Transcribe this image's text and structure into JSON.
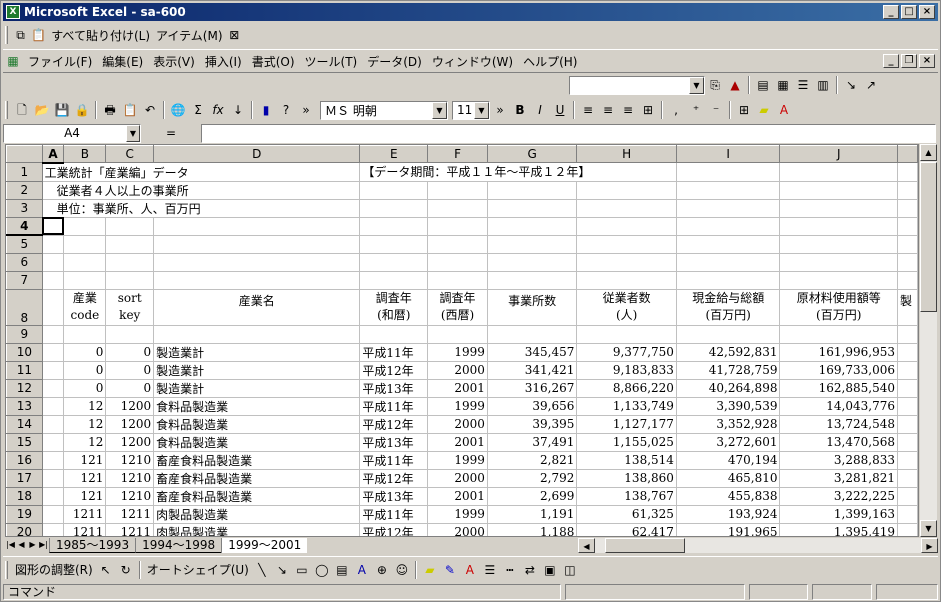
{
  "window": {
    "title": "Microsoft Excel - sa-600"
  },
  "clipboard_bar": {
    "paste_all": "すべて貼り付け(L)",
    "item": "アイテム(M)"
  },
  "menu": [
    "ファイル(F)",
    "編集(E)",
    "表示(V)",
    "挿入(I)",
    "書式(O)",
    "ツール(T)",
    "データ(D)",
    "ウィンドウ(W)",
    "ヘルプ(H)"
  ],
  "formatting": {
    "font": "ＭＳ 明朝",
    "size": "11"
  },
  "formula_bar": {
    "namebox": "A4",
    "eq": "="
  },
  "columns": [
    "A",
    "B",
    "C",
    "D",
    "E",
    "F",
    "G",
    "H",
    "I",
    "J"
  ],
  "rows": [
    {
      "n": "1",
      "a": "工業統計「産業編」データ",
      "e": "【データ期間：平成１１年～平成１２年】"
    },
    {
      "n": "2",
      "a": "　従業者４人以上の事業所"
    },
    {
      "n": "3",
      "a": "　単位：事業所、人、百万円"
    },
    {
      "n": "4"
    },
    {
      "n": "5"
    },
    {
      "n": "6"
    },
    {
      "n": "7"
    }
  ],
  "header_row": {
    "n": "8",
    "b": [
      "産業",
      "code"
    ],
    "c": [
      "sort",
      "key"
    ],
    "d": "産業名",
    "e": [
      "調査年",
      "(和暦)"
    ],
    "f": [
      "調査年",
      "(西暦)"
    ],
    "g": "事業所数",
    "h": [
      "従業者数",
      "(人)"
    ],
    "i": [
      "現金給与総額",
      "(百万円)"
    ],
    "j": [
      "原材料使用額等",
      "(百万円)"
    ],
    "k": "製"
  },
  "data_rows": [
    {
      "n": "9",
      "b": "",
      "c": "",
      "d": "",
      "e": "",
      "f": "",
      "g": "",
      "h": "",
      "i": "",
      "j": ""
    },
    {
      "n": "10",
      "b": "0",
      "c": "0",
      "d": "製造業計",
      "e": "平成11年",
      "f": "1999",
      "g": "345,457",
      "h": "9,377,750",
      "i": "42,592,831",
      "j": "161,996,953"
    },
    {
      "n": "11",
      "b": "0",
      "c": "0",
      "d": "製造業計",
      "e": "平成12年",
      "f": "2000",
      "g": "341,421",
      "h": "9,183,833",
      "i": "41,728,759",
      "j": "169,733,006"
    },
    {
      "n": "12",
      "b": "0",
      "c": "0",
      "d": "製造業計",
      "e": "平成13年",
      "f": "2001",
      "g": "316,267",
      "h": "8,866,220",
      "i": "40,264,898",
      "j": "162,885,540"
    },
    {
      "n": "13",
      "b": "12",
      "c": "1200",
      "d": "食料品製造業",
      "e": "平成11年",
      "f": "1999",
      "g": "39,656",
      "h": "1,133,749",
      "i": "3,390,539",
      "j": "14,043,776"
    },
    {
      "n": "14",
      "b": "12",
      "c": "1200",
      "d": "食料品製造業",
      "e": "平成12年",
      "f": "2000",
      "g": "39,395",
      "h": "1,127,177",
      "i": "3,352,928",
      "j": "13,724,548"
    },
    {
      "n": "15",
      "b": "12",
      "c": "1200",
      "d": "食料品製造業",
      "e": "平成13年",
      "f": "2001",
      "g": "37,491",
      "h": "1,155,025",
      "i": "3,272,601",
      "j": "13,470,568"
    },
    {
      "n": "16",
      "b": "121",
      "c": "1210",
      "d": "畜産食料品製造業",
      "e": "平成11年",
      "f": "1999",
      "g": "2,821",
      "h": "138,514",
      "i": "470,194",
      "j": "3,288,833"
    },
    {
      "n": "17",
      "b": "121",
      "c": "1210",
      "d": "畜産食料品製造業",
      "e": "平成12年",
      "f": "2000",
      "g": "2,792",
      "h": "138,860",
      "i": "465,810",
      "j": "3,281,821"
    },
    {
      "n": "18",
      "b": "121",
      "c": "1210",
      "d": "畜産食料品製造業",
      "e": "平成13年",
      "f": "2001",
      "g": "2,699",
      "h": "138,767",
      "i": "455,838",
      "j": "3,222,225"
    },
    {
      "n": "19",
      "b": "1211",
      "c": "1211",
      "d": "肉製品製造業",
      "e": "平成11年",
      "f": "1999",
      "g": "1,191",
      "h": "61,325",
      "i": "193,924",
      "j": "1,399,163"
    },
    {
      "n": "20",
      "b": "1211",
      "c": "1211",
      "d": "肉製品製造業",
      "e": "平成12年",
      "f": "2000",
      "g": "1,188",
      "h": "62,417",
      "i": "191,965",
      "j": "1,395,419"
    }
  ],
  "sheet_tabs": [
    "1985～1993",
    "1994～1998",
    "1999～2001"
  ],
  "active_tab": "1999～2001",
  "drawing": {
    "adjust": "図形の調整(R)",
    "autoshape": "オートシェイプ(U)"
  },
  "status": {
    "mode": "コマンド"
  }
}
